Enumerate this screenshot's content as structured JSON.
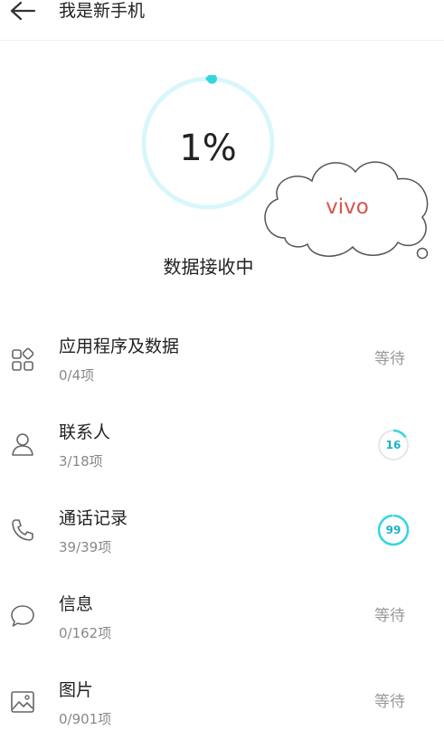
{
  "header": {
    "back_icon": "arrow-left-icon",
    "title": "我是新手机"
  },
  "transfer": {
    "progress": 0.01,
    "progress_text": "1%",
    "status": "数据接收中",
    "accent": "#33d6e0"
  },
  "watermark": {
    "text": "vivo",
    "color": "#d9534f"
  },
  "items": [
    {
      "icon": "apps-grid-icon",
      "label": "应用程序及数据",
      "count": "0/4项",
      "state": "等待"
    },
    {
      "icon": "contact-person-icon",
      "label": "联系人",
      "count": "3/18项",
      "ring_value": "16",
      "ring_progress": 0.16
    },
    {
      "icon": "phone-icon",
      "label": "通话记录",
      "count": "39/39项",
      "ring_value": "99",
      "ring_progress": 0.99
    },
    {
      "icon": "message-bubble-icon",
      "label": "信息",
      "count": "0/162项",
      "state": "等待"
    },
    {
      "icon": "picture-icon",
      "label": "图片",
      "count": "0/901项",
      "state": "等待"
    }
  ]
}
